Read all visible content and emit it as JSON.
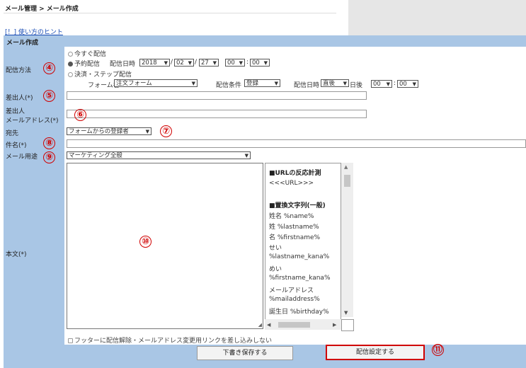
{
  "breadcrumb": "メール管理 > メール作成",
  "hint_link": "[！] 使い方のヒント",
  "section_title": "メール作成",
  "labels": {
    "delivery_method": "配信方法",
    "sender": "差出人(*)",
    "sender_email_line1": "差出人",
    "sender_email_line2": "メールアドレス(*)",
    "recipient": "宛先",
    "subject": "件名(*)",
    "mail_use": "メール用途",
    "body": "本文(*)"
  },
  "delivery": {
    "opt_now": "今すぐ配信",
    "opt_scheduled": "予約配信",
    "scheduled_label": "配信日時",
    "year": "2018",
    "month": "02",
    "day": "27",
    "hour": "00",
    "minute": "00",
    "opt_step": "決済・ステップ配信",
    "form_name_label": "フォーム名",
    "form_name_value": "注文フォーム",
    "condition_label": "配信条件",
    "condition_value": "登録",
    "step_datetime_label": "配信日時",
    "step_timing_value": "直後",
    "step_days_after": "日後",
    "step_hour": "00",
    "step_minute": "00",
    "date_sep": "/",
    "time_sep": ":"
  },
  "recipient_value": "フォームからの登録者",
  "mail_use_value": "マーケティング全般",
  "sidebar_lines": [
    "■URLの反応計測",
    "<<<URL>>>",
    "",
    "■置換文字列(一般)",
    "姓名 %name%",
    "姓 %lastname%",
    "名 %firstname%",
    "せい",
    "%lastname_kana%",
    "めい",
    "%firstname_kana%",
    "メールアドレス",
    "%mailaddress%",
    "誕生日 %birthday%"
  ],
  "footer_option": "フッターに配信解除・メールアドレス変更用リンクを差し込みしない",
  "buttons": {
    "save_draft": "下書き保存する",
    "delivery_settings": "配信設定する"
  },
  "callouts": {
    "n4": "④",
    "n5": "⑤",
    "n6": "⑥",
    "n7": "⑦",
    "n8": "⑧",
    "n9": "⑨",
    "n10": "⑩",
    "n11": "⑪"
  },
  "colors": {
    "section_bg": "#a9c6e5",
    "callout_red": "#d00000",
    "link_blue": "#1a4db5"
  }
}
